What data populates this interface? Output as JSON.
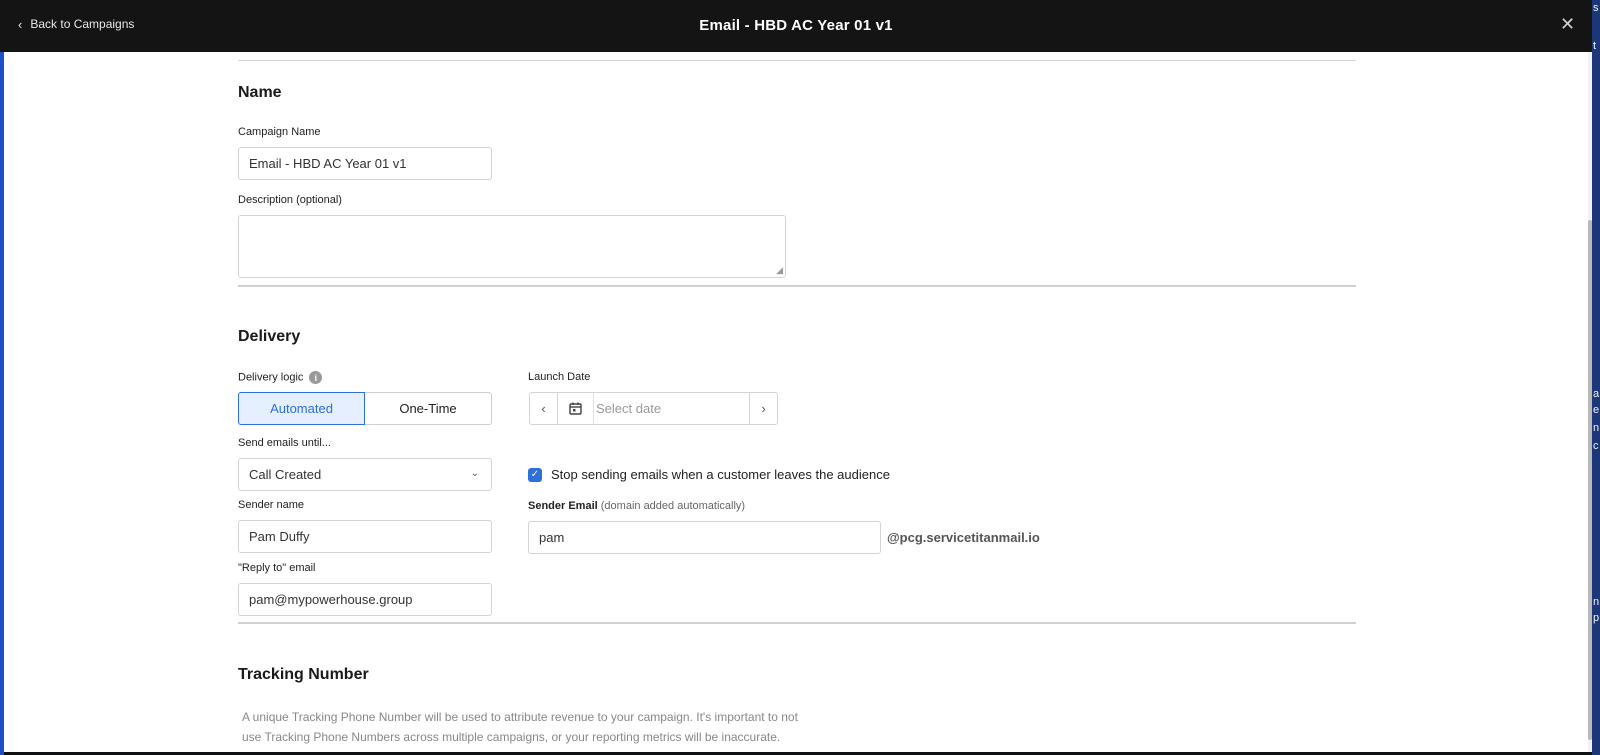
{
  "header": {
    "back_label": "Back to Campaigns",
    "title": "Email - HBD AC Year 01 v1",
    "close_symbol": "✕"
  },
  "name_section": {
    "heading": "Name",
    "campaign_name_label": "Campaign Name",
    "campaign_name_value": "Email - HBD AC Year 01 v1",
    "description_label": "Description (optional)",
    "description_value": ""
  },
  "delivery": {
    "heading": "Delivery",
    "logic_label": "Delivery logic",
    "logic_options": [
      "Automated",
      "One-Time"
    ],
    "logic_selected": "Automated",
    "launch_date_label": "Launch Date",
    "launch_date_placeholder": "Select date",
    "send_until_label": "Send emails until...",
    "send_until_value": "Call Created",
    "stop_sending_label": "Stop sending emails when a customer leaves the audience",
    "stop_sending_checked": true,
    "sender_name_label": "Sender name",
    "sender_name_value": "Pam Duffy",
    "sender_email_label": "Sender Email",
    "sender_email_hint": "(domain added automatically)",
    "sender_email_value": "pam",
    "sender_email_domain": "@pcg.servicetitanmail.io",
    "reply_to_label": "\"Reply to\" email",
    "reply_to_value": "pam@mypowerhouse.group"
  },
  "tracking": {
    "heading": "Tracking Number",
    "description_line1": "A unique Tracking Phone Number will be used to attribute revenue to your campaign. It's important to not",
    "description_line2": "use Tracking Phone Numbers across multiple campaigns, or your reporting metrics will be inaccurate."
  },
  "edge_fragments": [
    "s",
    "t",
    "a",
    "e",
    "n",
    "c",
    "n",
    "p"
  ],
  "colors": {
    "accent": "#2e6fde",
    "topbar": "#141414",
    "edge_blue": "#1e4fc6"
  }
}
